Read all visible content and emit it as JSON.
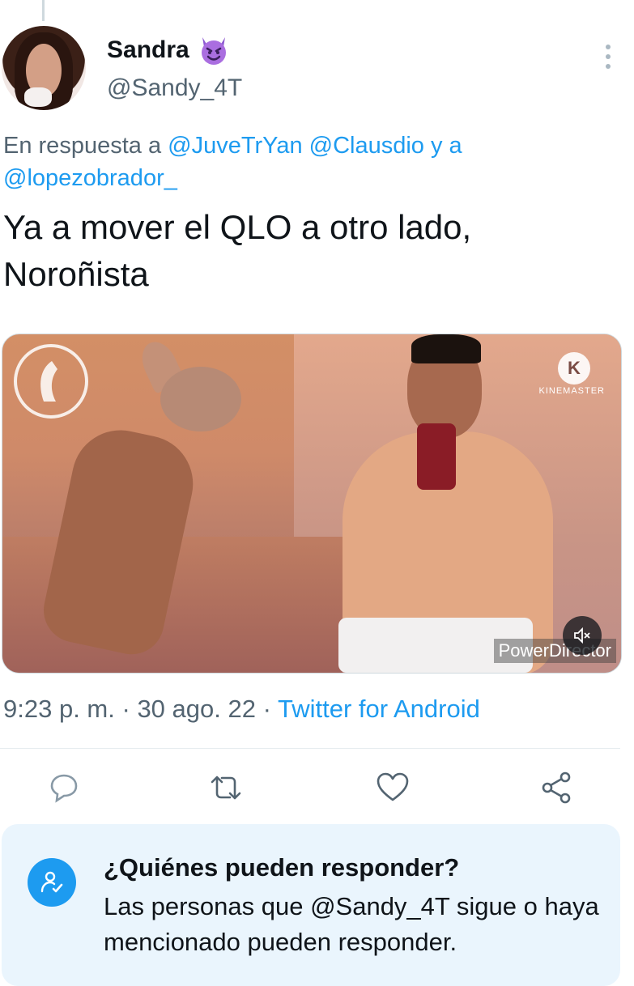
{
  "author": {
    "display_name": "Sandra",
    "name_emoji": "smiling-imp-emoji",
    "handle": "@Sandy_4T"
  },
  "reply_to": {
    "prefix": "En respuesta a",
    "mention_1": "@JuveTrYan",
    "mention_2": "@Clausdio",
    "conjunction": "y a",
    "mention_3": "@lopezobrador_"
  },
  "tweet": {
    "text": "Ya a mover el QLO a otro lado, Noroñista"
  },
  "media": {
    "watermark_top_right": "KINEMASTER",
    "watermark_top_right_letter": "K",
    "watermark_bottom_right": "PowerDirector"
  },
  "meta": {
    "time": "9:23 p. m.",
    "separator": "·",
    "date": "30 ago. 22",
    "source": "Twitter for Android"
  },
  "actions": [
    "reply-icon",
    "retweet-icon",
    "like-icon",
    "share-icon"
  ],
  "reply_restriction": {
    "title": "¿Quiénes pueden responder?",
    "description": "Las personas que @Sandy_4T sigue o haya mencionado pueden responder."
  },
  "colors": {
    "accent": "#1d9bf0",
    "secondary_text": "#536471",
    "card_background": "#eaf5fd"
  }
}
